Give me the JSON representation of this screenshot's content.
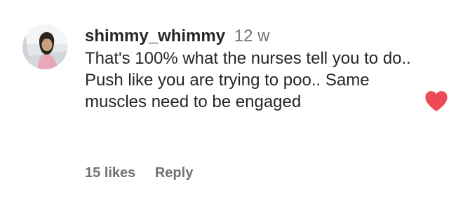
{
  "comment": {
    "username": "shimmy_whimmy",
    "timestamp": "12 w",
    "text": "That's 100% what the nurses tell you to do.. Push like you are trying to poo.. Same muscles need to be engaged",
    "likes_label": "15 likes",
    "reply_label": "Reply",
    "liked": true
  },
  "icons": {
    "avatar": "profile-photo",
    "like": "heart-icon-filled"
  },
  "colors": {
    "text": "#262626",
    "secondary": "#737373",
    "heart": "#ed4956",
    "background": "#ffffff"
  }
}
